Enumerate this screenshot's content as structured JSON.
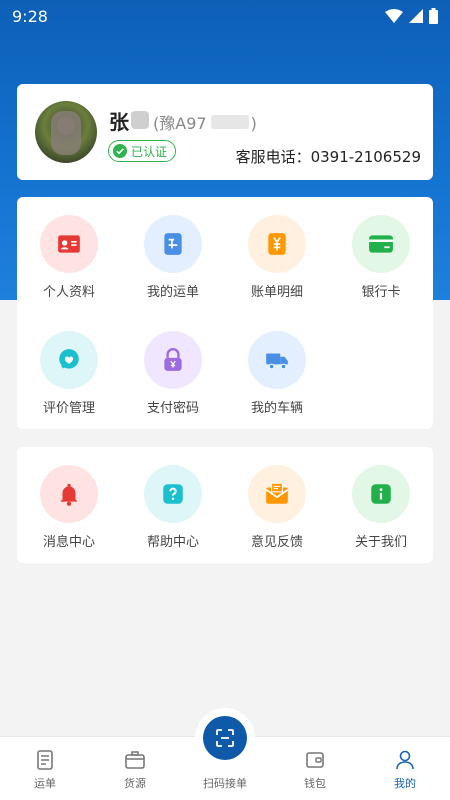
{
  "status_bar": {
    "time": "9:28"
  },
  "profile": {
    "name": "张",
    "plate": "(豫A97",
    "plate_suffix": ")",
    "verified_label": "已认证",
    "service_phone": "客服电话：0391-2106529"
  },
  "menu_primary": {
    "items": [
      {
        "label": "个人资料",
        "icon": "id-card-icon",
        "bg": "#ffe3e3",
        "fg": "#e53935"
      },
      {
        "label": "我的运单",
        "icon": "waybill-icon",
        "bg": "#e3efff",
        "fg": "#4a8fe6"
      },
      {
        "label": "账单明细",
        "icon": "bill-icon",
        "bg": "#fff0e0",
        "fg": "#ff9800"
      },
      {
        "label": "银行卡",
        "icon": "bank-card-icon",
        "bg": "#e3f7e6",
        "fg": "#21b04a"
      },
      {
        "label": "评价管理",
        "icon": "comment-icon",
        "bg": "#dff6f9",
        "fg": "#1bbfcf"
      },
      {
        "label": "支付密码",
        "icon": "lock-icon",
        "bg": "#f0e6ff",
        "fg": "#9c6be0"
      },
      {
        "label": "我的车辆",
        "icon": "truck-icon",
        "bg": "#e3efff",
        "fg": "#4a8fe6"
      }
    ]
  },
  "menu_secondary": {
    "items": [
      {
        "label": "消息中心",
        "icon": "bell-icon",
        "bg": "#ffe3e3",
        "fg": "#e53935"
      },
      {
        "label": "帮助中心",
        "icon": "help-icon",
        "bg": "#dff6f9",
        "fg": "#1bbfcf"
      },
      {
        "label": "意见反馈",
        "icon": "feedback-mail-icon",
        "bg": "#fff0e0",
        "fg": "#ff9800"
      },
      {
        "label": "关于我们",
        "icon": "info-icon",
        "bg": "#e3f7e6",
        "fg": "#21b04a"
      }
    ]
  },
  "tabbar": {
    "tabs": [
      {
        "label": "运单",
        "icon": "waybill-tab-icon",
        "active": false
      },
      {
        "label": "货源",
        "icon": "cargo-tab-icon",
        "active": false
      },
      {
        "label": "扫码接单",
        "icon": "scan-icon",
        "active": false
      },
      {
        "label": "钱包",
        "icon": "wallet-tab-icon",
        "active": false
      },
      {
        "label": "我的",
        "icon": "profile-tab-icon",
        "active": true
      }
    ]
  },
  "colors": {
    "brand": "#1565c0",
    "accent_blue": "#1a63b7",
    "verified_green": "#2fb24f"
  }
}
